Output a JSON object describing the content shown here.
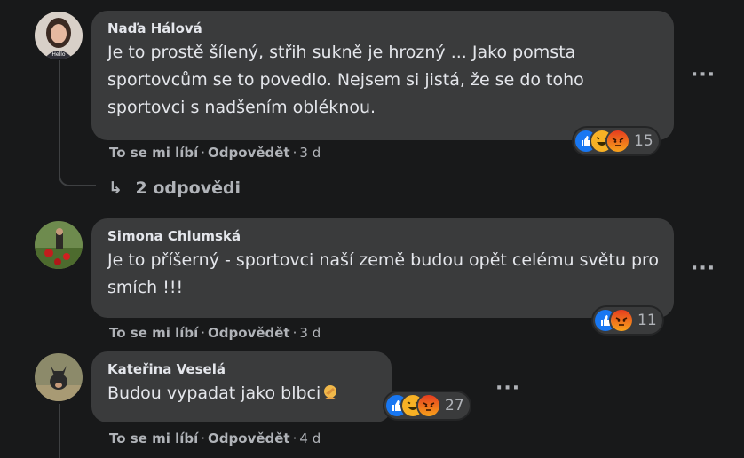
{
  "comments": [
    {
      "author": "Naďa Hálová",
      "text": "Je to prostě šílený, střih sukně je hrozný ... Jako pomsta sportovcům se to povedlo. Nejsem si jistá, že se do toho sportovci s nadšením obléknou.",
      "like_label": "To se mi líbí",
      "reply_label": "Odpovědět",
      "time": "3 d",
      "reaction_count": "15",
      "reactions": [
        "like",
        "laugh",
        "angry"
      ],
      "replies_label": "2 odpovědi",
      "avatar_label": "Hello"
    },
    {
      "author": "Simona Chlumská",
      "text": "Je to příšerný - sportovci naší země budou opět celému světu pro smích !!!",
      "like_label": "To se mi líbí",
      "reply_label": "Odpovědět",
      "time": "3 d",
      "reaction_count": "11",
      "reactions": [
        "like",
        "angry"
      ]
    },
    {
      "author": "Kateřina Veselá",
      "text": "Budou vypadat jako blbci",
      "like_label": "To se mi líbí",
      "reply_label": "Odpovědět",
      "time": "4 d",
      "reaction_count": "27",
      "reactions": [
        "like",
        "laugh",
        "angry"
      ],
      "emoji": "facepalm"
    }
  ],
  "colors": {
    "background": "#18191a",
    "bubble": "#3a3b3c",
    "text": "#e4e6eb",
    "secondary": "#b0b3b8",
    "like": "#1877f2",
    "laugh": "#f7b125",
    "angry": "#e9710f"
  }
}
